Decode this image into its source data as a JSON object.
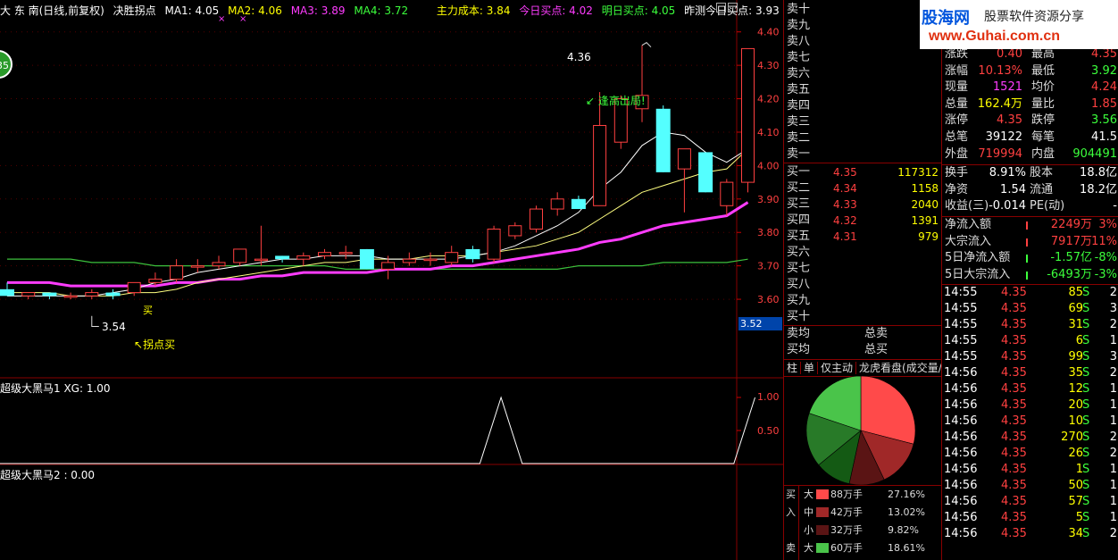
{
  "title": {
    "stock_name": "大 东 南(日线,前复权)",
    "indicator": "决胜拐点",
    "ma1": "MA1: 4.05",
    "ma2": "MA2: 4.06",
    "ma3": "MA3: 3.89",
    "ma4": "MA4: 3.72",
    "main_cost": "主力成本: 3.84",
    "today_buy": "今日买点: 4.02",
    "tomorrow_buy": "明日买点: 4.05",
    "predict_today": "昨测今日买点: 3.93"
  },
  "colors": {
    "ma1": "#ffffff",
    "ma2": "#ffff00",
    "ma3": "#ff3cff",
    "ma4": "#3cff3c",
    "main_cost": "#ffff00",
    "today_buy": "#ff3cff",
    "tomorrow_buy": "#3cff3c",
    "predict_today": "#ffffff"
  },
  "price_axis": [
    "4.40",
    "4.30",
    "4.20",
    "4.10",
    "4.00",
    "3.90",
    "3.80",
    "3.70",
    "3.60"
  ],
  "current_price_tag": "3.52",
  "annotations": {
    "high_label": "4.36",
    "low_label": "3.54",
    "sell_note": "逢高出局!",
    "buy_note": "拐点买",
    "buy_short": "买"
  },
  "round_badge": "35",
  "sub1": {
    "label": "超级大黑马1  XG: 1.00",
    "ticks": [
      "1.00",
      "0.50"
    ]
  },
  "sub2": {
    "label": "超级大黑马2 : 0.00"
  },
  "sell_levels": [
    "卖十",
    "卖九",
    "卖八",
    "卖七",
    "卖六",
    "卖五",
    "卖四",
    "卖三",
    "卖二",
    "卖一"
  ],
  "buy_levels": [
    {
      "label": "买一",
      "price": "4.35",
      "vol": "117312"
    },
    {
      "label": "买二",
      "price": "4.34",
      "vol": "1158"
    },
    {
      "label": "买三",
      "price": "4.33",
      "vol": "2040"
    },
    {
      "label": "买四",
      "price": "4.32",
      "vol": "1391"
    },
    {
      "label": "买五",
      "price": "4.31",
      "vol": "979"
    },
    {
      "label": "买六",
      "price": "",
      "vol": ""
    },
    {
      "label": "买七",
      "price": "",
      "vol": ""
    },
    {
      "label": "买八",
      "price": "",
      "vol": ""
    },
    {
      "label": "买九",
      "price": "",
      "vol": ""
    },
    {
      "label": "买十",
      "price": "",
      "vol": ""
    }
  ],
  "avg": {
    "sell_avg": "卖均",
    "buy_avg": "买均",
    "total_sell": "总卖",
    "total_buy": "总买"
  },
  "tabs": [
    "柱",
    "单",
    "仅主动",
    "龙虎看盘(成交量/质"
  ],
  "pie": [
    {
      "name": "buy-big",
      "value": 27.16,
      "color": "#ff4a4a"
    },
    {
      "name": "buy-mid",
      "value": 13.02,
      "color": "#a02828"
    },
    {
      "name": "buy-small",
      "value": 9.82,
      "color": "#5a1414"
    },
    {
      "name": "sell-small",
      "value": 10.0,
      "color": "#145a14"
    },
    {
      "name": "sell-mid",
      "value": 15.0,
      "color": "#287a28"
    },
    {
      "name": "sell-big",
      "value": 18.61,
      "color": "#4ac44a"
    }
  ],
  "legend": [
    {
      "side": "买",
      "size": "大",
      "vol": "88万手",
      "pct": "27.16%",
      "color": "#ff4a4a"
    },
    {
      "side": "入",
      "size": "中",
      "vol": "42万手",
      "pct": "13.02%",
      "color": "#a02828"
    },
    {
      "side": "",
      "size": "小",
      "vol": "32万手",
      "pct": "9.82%",
      "color": "#5a1414"
    },
    {
      "side": "卖",
      "size": "大",
      "vol": "60万手",
      "pct": "18.61%",
      "color": "#4ac44a"
    }
  ],
  "logo": {
    "main": "股海网",
    "sub": "股票软件资源分享",
    "url": "www.Guhai.com.cn"
  },
  "quote": [
    {
      "l1": "涨跌",
      "v1": "0.40",
      "c1": "red",
      "l2": "最高",
      "v2": "4.35",
      "c2": "red"
    },
    {
      "l1": "涨幅",
      "v1": "10.13%",
      "c1": "red",
      "l2": "最低",
      "v2": "3.92",
      "c2": "green"
    },
    {
      "l1": "现量",
      "v1": "1521",
      "c1": "mag",
      "l2": "均价",
      "v2": "4.24",
      "c2": "red"
    },
    {
      "l1": "总量",
      "v1": "162.4万",
      "c1": "yellow",
      "l2": "量比",
      "v2": "1.85",
      "c2": "red"
    },
    {
      "l1": "涨停",
      "v1": "4.35",
      "c1": "red",
      "l2": "跌停",
      "v2": "3.56",
      "c2": "green"
    },
    {
      "l1": "总笔",
      "v1": "39122",
      "c1": "white",
      "l2": "每笔",
      "v2": "41.5",
      "c2": "white"
    },
    {
      "l1": "外盘",
      "v1": "719994",
      "c1": "red",
      "l2": "内盘",
      "v2": "904491",
      "c2": "green"
    }
  ],
  "fund": [
    {
      "l1": "换手",
      "v1": "8.91%",
      "l2": "股本",
      "v2": "18.8亿"
    },
    {
      "l1": "净资",
      "v1": "1.54",
      "l2": "流通",
      "v2": "18.2亿"
    },
    {
      "l1": "收益(三)",
      "v1": "-0.014",
      "l2": "PE(动)",
      "v2": "-"
    }
  ],
  "flow": [
    {
      "label": "净流入额",
      "value": "2249万",
      "pct": "3%",
      "color": "red"
    },
    {
      "label": "大宗流入",
      "value": "7917万",
      "pct": "11%",
      "color": "red"
    },
    {
      "label": "5日净流入额",
      "value": "-1.57亿",
      "pct": "-8%",
      "color": "green"
    },
    {
      "label": "5日大宗流入",
      "value": "-6493万",
      "pct": "-3%",
      "color": "green"
    }
  ],
  "ticks": [
    {
      "t": "14:55",
      "p": "4.35",
      "v": "85",
      "s": "S",
      "n": "2"
    },
    {
      "t": "14:55",
      "p": "4.35",
      "v": "69",
      "s": "S",
      "n": "3"
    },
    {
      "t": "14:55",
      "p": "4.35",
      "v": "31",
      "s": "S",
      "n": "2"
    },
    {
      "t": "14:55",
      "p": "4.35",
      "v": "6",
      "s": "S",
      "n": "1"
    },
    {
      "t": "14:55",
      "p": "4.35",
      "v": "99",
      "s": "S",
      "n": "3"
    },
    {
      "t": "14:56",
      "p": "4.35",
      "v": "35",
      "s": "S",
      "n": "2"
    },
    {
      "t": "14:56",
      "p": "4.35",
      "v": "12",
      "s": "S",
      "n": "1"
    },
    {
      "t": "14:56",
      "p": "4.35",
      "v": "20",
      "s": "S",
      "n": "1"
    },
    {
      "t": "14:56",
      "p": "4.35",
      "v": "10",
      "s": "S",
      "n": "1"
    },
    {
      "t": "14:56",
      "p": "4.35",
      "v": "270",
      "s": "S",
      "n": "2"
    },
    {
      "t": "14:56",
      "p": "4.35",
      "v": "26",
      "s": "S",
      "n": "2"
    },
    {
      "t": "14:56",
      "p": "4.35",
      "v": "1",
      "s": "S",
      "n": "1"
    },
    {
      "t": "14:56",
      "p": "4.35",
      "v": "50",
      "s": "S",
      "n": "1"
    },
    {
      "t": "14:56",
      "p": "4.35",
      "v": "57",
      "s": "S",
      "n": "1"
    },
    {
      "t": "14:56",
      "p": "4.35",
      "v": "5",
      "s": "S",
      "n": "1"
    },
    {
      "t": "14:56",
      "p": "4.35",
      "v": "34",
      "s": "S",
      "n": "2"
    }
  ],
  "candles": [
    {
      "o": 3.63,
      "h": 3.65,
      "l": 3.61,
      "c": 3.61
    },
    {
      "o": 3.61,
      "h": 3.62,
      "l": 3.6,
      "c": 3.62
    },
    {
      "o": 3.62,
      "h": 3.62,
      "l": 3.6,
      "c": 3.61
    },
    {
      "o": 3.61,
      "h": 3.62,
      "l": 3.6,
      "c": 3.61
    },
    {
      "o": 3.61,
      "h": 3.63,
      "l": 3.6,
      "c": 3.62
    },
    {
      "o": 3.62,
      "h": 3.63,
      "l": 3.6,
      "c": 3.61
    },
    {
      "o": 3.62,
      "h": 3.65,
      "l": 3.61,
      "c": 3.65
    },
    {
      "o": 3.65,
      "h": 3.68,
      "l": 3.64,
      "c": 3.66
    },
    {
      "o": 3.66,
      "h": 3.72,
      "l": 3.65,
      "c": 3.7
    },
    {
      "o": 3.7,
      "h": 3.72,
      "l": 3.68,
      "c": 3.7
    },
    {
      "o": 3.7,
      "h": 3.73,
      "l": 3.69,
      "c": 3.71
    },
    {
      "o": 3.71,
      "h": 3.75,
      "l": 3.7,
      "c": 3.75
    },
    {
      "o": 3.72,
      "h": 3.82,
      "l": 3.7,
      "c": 3.72
    },
    {
      "o": 3.73,
      "h": 3.73,
      "l": 3.71,
      "c": 3.72
    },
    {
      "o": 3.72,
      "h": 3.74,
      "l": 3.7,
      "c": 3.73
    },
    {
      "o": 3.73,
      "h": 3.75,
      "l": 3.72,
      "c": 3.74
    },
    {
      "o": 3.74,
      "h": 3.76,
      "l": 3.72,
      "c": 3.74
    },
    {
      "o": 3.75,
      "h": 3.75,
      "l": 3.69,
      "c": 3.69
    },
    {
      "o": 3.69,
      "h": 3.73,
      "l": 3.66,
      "c": 3.71
    },
    {
      "o": 3.71,
      "h": 3.74,
      "l": 3.7,
      "c": 3.72
    },
    {
      "o": 3.72,
      "h": 3.74,
      "l": 3.7,
      "c": 3.72
    },
    {
      "o": 3.71,
      "h": 3.76,
      "l": 3.7,
      "c": 3.74
    },
    {
      "o": 3.75,
      "h": 3.76,
      "l": 3.71,
      "c": 3.72
    },
    {
      "o": 3.72,
      "h": 3.82,
      "l": 3.71,
      "c": 3.81
    },
    {
      "o": 3.79,
      "h": 3.83,
      "l": 3.78,
      "c": 3.82
    },
    {
      "o": 3.81,
      "h": 3.88,
      "l": 3.8,
      "c": 3.87
    },
    {
      "o": 3.87,
      "h": 3.92,
      "l": 3.85,
      "c": 3.9
    },
    {
      "o": 3.9,
      "h": 3.91,
      "l": 3.87,
      "c": 3.87
    },
    {
      "o": 3.88,
      "h": 4.22,
      "l": 3.88,
      "c": 4.12
    },
    {
      "o": 4.07,
      "h": 4.21,
      "l": 4.05,
      "c": 4.2
    },
    {
      "o": 4.17,
      "h": 4.36,
      "l": 4.13,
      "c": 4.21
    },
    {
      "o": 4.17,
      "h": 4.18,
      "l": 3.98,
      "c": 3.98
    },
    {
      "o": 3.99,
      "h": 4.05,
      "l": 3.86,
      "c": 4.05
    },
    {
      "o": 4.04,
      "h": 4.04,
      "l": 3.92,
      "c": 3.92
    },
    {
      "o": 3.88,
      "h": 3.96,
      "l": 3.85,
      "c": 3.95
    },
    {
      "o": 3.95,
      "h": 4.35,
      "l": 3.92,
      "c": 4.35
    }
  ],
  "ma_lines": {
    "ma_white": [
      3.61,
      3.61,
      3.61,
      3.61,
      3.61,
      3.62,
      3.63,
      3.65,
      3.66,
      3.68,
      3.69,
      3.7,
      3.71,
      3.72,
      3.72,
      3.73,
      3.73,
      3.73,
      3.72,
      3.72,
      3.72,
      3.72,
      3.73,
      3.74,
      3.76,
      3.79,
      3.82,
      3.86,
      3.93,
      3.98,
      4.06,
      4.1,
      4.09,
      4.04,
      4.01,
      4.05
    ],
    "ma_yellow": [
      3.62,
      3.62,
      3.62,
      3.61,
      3.61,
      3.61,
      3.62,
      3.62,
      3.63,
      3.65,
      3.66,
      3.67,
      3.68,
      3.69,
      3.7,
      3.71,
      3.71,
      3.72,
      3.72,
      3.72,
      3.73,
      3.73,
      3.73,
      3.74,
      3.75,
      3.76,
      3.78,
      3.8,
      3.84,
      3.88,
      3.92,
      3.94,
      3.96,
      3.98,
      3.99,
      4.05
    ],
    "ma_magenta": [
      3.65,
      3.65,
      3.65,
      3.64,
      3.64,
      3.64,
      3.64,
      3.64,
      3.65,
      3.65,
      3.66,
      3.66,
      3.67,
      3.67,
      3.68,
      3.68,
      3.68,
      3.68,
      3.69,
      3.69,
      3.69,
      3.7,
      3.7,
      3.71,
      3.72,
      3.73,
      3.74,
      3.75,
      3.77,
      3.78,
      3.8,
      3.82,
      3.83,
      3.84,
      3.85,
      3.89
    ],
    "ma_green": [
      3.72,
      3.72,
      3.72,
      3.72,
      3.71,
      3.71,
      3.71,
      3.7,
      3.7,
      3.7,
      3.7,
      3.7,
      3.7,
      3.7,
      3.7,
      3.7,
      3.69,
      3.69,
      3.69,
      3.69,
      3.69,
      3.69,
      3.69,
      3.69,
      3.69,
      3.69,
      3.69,
      3.7,
      3.7,
      3.7,
      3.7,
      3.71,
      3.71,
      3.71,
      3.71,
      3.72
    ]
  },
  "xg_signal": [
    0,
    0,
    0,
    0,
    0,
    0,
    0,
    0,
    0,
    0,
    0,
    0,
    0,
    0,
    0,
    0,
    0,
    0,
    0,
    0,
    0,
    0,
    0,
    1,
    0,
    0,
    0,
    0,
    0,
    0,
    0,
    0,
    0,
    0,
    0,
    1
  ]
}
